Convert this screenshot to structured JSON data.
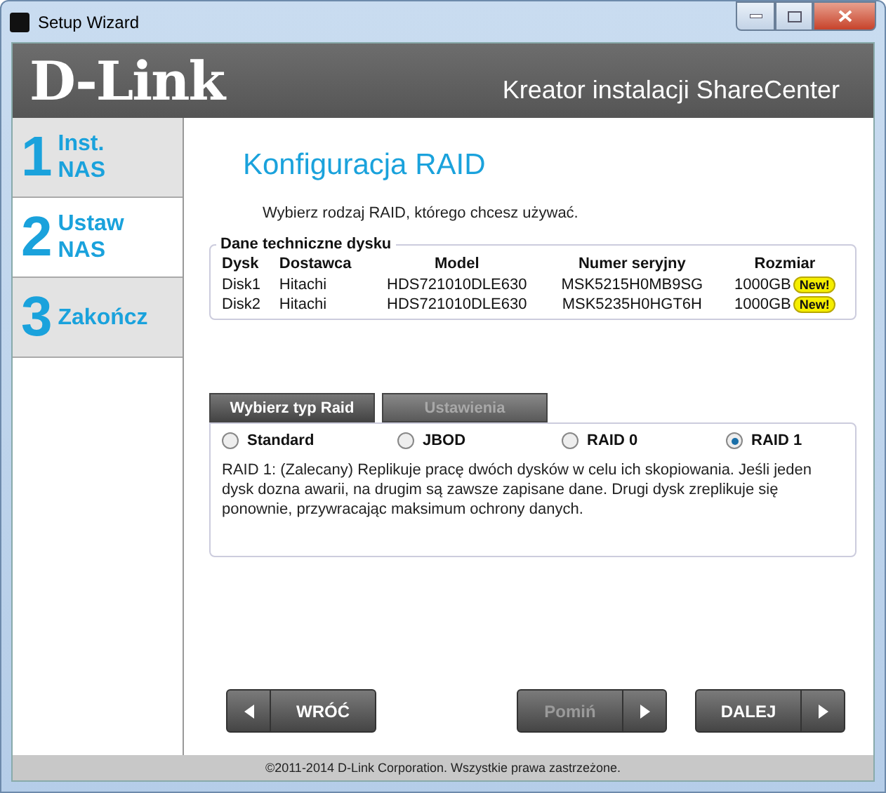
{
  "window": {
    "title": "Setup Wizard"
  },
  "header": {
    "logo": "D-Link",
    "title": "Kreator instalacji ShareCenter"
  },
  "steps": [
    {
      "number": "1",
      "lines": [
        "Inst.",
        "NAS"
      ],
      "selected": false
    },
    {
      "number": "2",
      "lines": [
        "Ustaw",
        "NAS"
      ],
      "selected": true
    },
    {
      "number": "3",
      "lines": [
        "Zakończ"
      ],
      "selected": false
    }
  ],
  "heading": "Konfiguracja RAID",
  "instruction": "Wybierz rodzaj RAID, którego chcesz używać.",
  "disk_info": {
    "legend": "Dane techniczne dysku",
    "columns": [
      "Dysk",
      "Dostawca",
      "Model",
      "Numer seryjny",
      "Rozmiar"
    ],
    "rows": [
      {
        "cells": [
          "Disk1",
          "Hitachi",
          "HDS721010DLE630",
          "MSK5215H0MB9SG",
          "1000GB"
        ],
        "badge": "New!"
      },
      {
        "cells": [
          "Disk2",
          "Hitachi",
          "HDS721010DLE630",
          "MSK5235H0HGT6H",
          "1000GB"
        ],
        "badge": "New!"
      }
    ]
  },
  "tabs": [
    {
      "label": "Wybierz typ Raid",
      "selected": true,
      "disabled": false
    },
    {
      "label": "Ustawienia",
      "selected": false,
      "disabled": true
    }
  ],
  "raid_options": [
    {
      "label": "Standard",
      "selected": false
    },
    {
      "label": "JBOD",
      "selected": false
    },
    {
      "label": "RAID 0",
      "selected": false
    },
    {
      "label": "RAID 1",
      "selected": true
    }
  ],
  "description": "RAID 1: (Zalecany) Replikuje pracę dwóch dysków w celu ich skopiowania. Jeśli jeden dysk dozna awarii, na drugim są zawsze zapisane dane. Drugi dysk zreplikuje się ponownie, przywracając maksimum ochrony danych.",
  "buttons": [
    {
      "label": "WRÓĆ",
      "arrow_left": true,
      "disabled": false
    },
    {
      "label": "Pomiń",
      "arrow_left": false,
      "disabled": true
    },
    {
      "label": "DALEJ",
      "arrow_left": false,
      "disabled": false
    }
  ],
  "footer": "©2011-2014 D-Link Corporation. Wszystkie prawa zastrzeżone."
}
